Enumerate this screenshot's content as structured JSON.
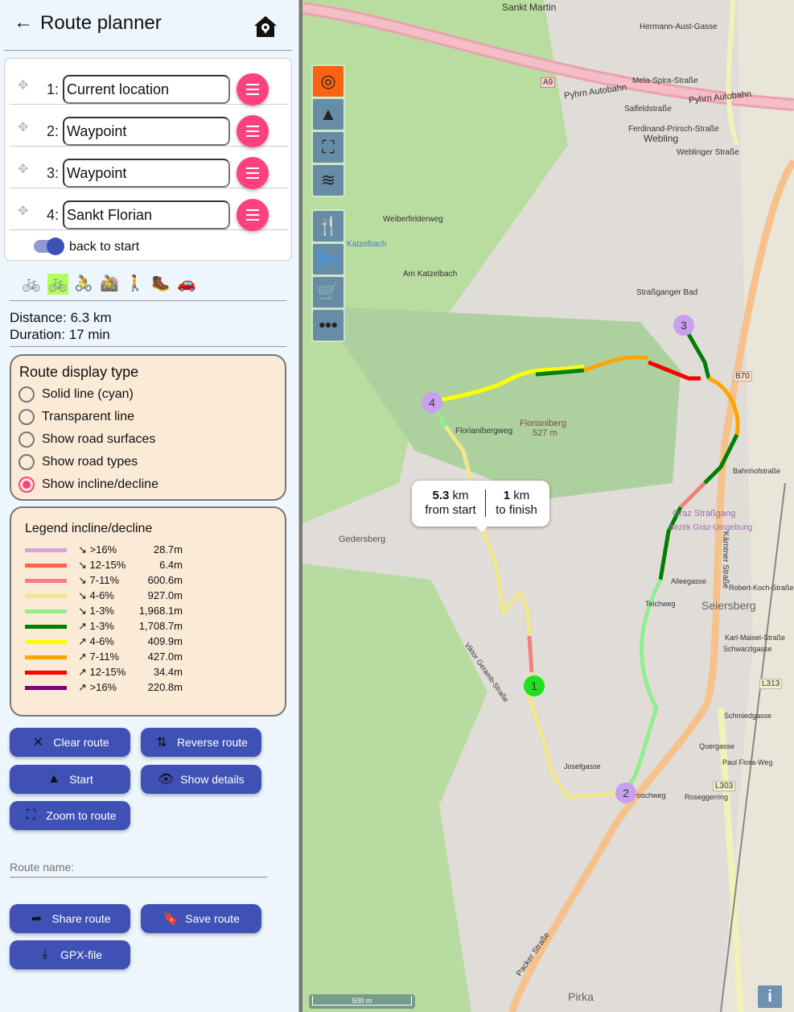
{
  "header": {
    "title": "Route planner",
    "back_icon": "←",
    "home_icon": "home-pin-icon"
  },
  "waypoints": [
    {
      "index": "1:",
      "value": "Current location"
    },
    {
      "index": "2:",
      "value": "Waypoint"
    },
    {
      "index": "3:",
      "value": "Waypoint"
    },
    {
      "index": "4:",
      "value": "Sankt Florian"
    }
  ],
  "back_to_start": {
    "label": "back to start",
    "enabled": true
  },
  "modes": [
    {
      "name": "bike",
      "glyph": "🚲",
      "active": false
    },
    {
      "name": "e-bike",
      "glyph": "🚲",
      "active": true
    },
    {
      "name": "road-bike",
      "glyph": "🚴",
      "active": false
    },
    {
      "name": "mountain-bike",
      "glyph": "🚵",
      "active": false
    },
    {
      "name": "walk",
      "glyph": "🚶",
      "active": false
    },
    {
      "name": "hike",
      "glyph": "🥾",
      "active": false
    },
    {
      "name": "car",
      "glyph": "🚗",
      "active": false
    }
  ],
  "stats": {
    "distance": "Distance: 6.3 km",
    "duration": "Duration: 17 min"
  },
  "display_type": {
    "title": "Route display type",
    "options": [
      {
        "label": "Solid line (cyan)",
        "selected": false
      },
      {
        "label": "Transparent line",
        "selected": false
      },
      {
        "label": "Show road surfaces",
        "selected": false
      },
      {
        "label": "Show road types",
        "selected": false
      },
      {
        "label": "Show incline/decline",
        "selected": true
      }
    ]
  },
  "legend": {
    "title": "Legend incline/decline",
    "items": [
      {
        "label": "↘ >16%",
        "value": "28.7m",
        "color": "#dda0dd"
      },
      {
        "label": "↘ 12-15%",
        "value": "6.4m",
        "color": "#ff6347"
      },
      {
        "label": "↘ 7-11%",
        "value": "600.6m",
        "color": "#f08080"
      },
      {
        "label": "↘ 4-6%",
        "value": "927.0m",
        "color": "#f0e68c"
      },
      {
        "label": "↘ 1-3%",
        "value": "1,968.1m",
        "color": "#90ee90"
      },
      {
        "label": "↗ 1-3%",
        "value": "1,708.7m",
        "color": "#008000"
      },
      {
        "label": "↗ 4-6%",
        "value": "409.9m",
        "color": "#ffff00"
      },
      {
        "label": "↗ 7-11%",
        "value": "427.0m",
        "color": "#ffa500"
      },
      {
        "label": "↗ 12-15%",
        "value": "34.4m",
        "color": "#ff0000"
      },
      {
        "label": "↗ >16%",
        "value": "220.8m",
        "color": "#800080"
      }
    ]
  },
  "buttons": {
    "clear": "Clear route",
    "reverse": "Reverse route",
    "start": "Start",
    "details": "Show details",
    "zoom": "Zoom to route",
    "share": "Share route",
    "save": "Save route",
    "gpx": "GPX-file"
  },
  "route_name": {
    "placeholder": "Route name:",
    "value": ""
  },
  "map": {
    "popup": {
      "from_value": "5.3",
      "from_unit": " km",
      "from_label": "from start",
      "to_value": "1",
      "to_unit": " km",
      "to_label": "to finish"
    },
    "markers": [
      "1",
      "2",
      "3",
      "4"
    ],
    "scale": "500 m",
    "info": "i",
    "labels": [
      "Sankt Martin",
      "Pyhrn Autobahn",
      "Pyhrn Autobahn",
      "A9",
      "Webling",
      "Weblinger Straße",
      "Hermann-Aust-Gasse",
      "Mela-Spira-Straße",
      "Salfeldstraße",
      "Ferdinand-Prirsch-Straße",
      "Weiberfelderweg",
      "Katzelbach",
      "Am Katzelbach",
      "Straßganger Bad",
      "B70",
      "Florianiberg",
      "527 m",
      "Florianibergweg",
      "Gedersberg",
      "Graz Straßgang",
      "Bezirk Graz-Umgebung",
      "Seiersberg",
      "Kärntner Straße",
      "L313",
      "L303",
      "Alleegasse",
      "Teichweg",
      "Schmiedgasse",
      "Quergasse",
      "Josefgasse",
      "Pirka",
      "Packer Straße",
      "Viktor Geramb-Straße",
      "Bahnhofstraße",
      "Robert-Koch-Straße",
      "Karl-Maisel-Straße",
      "Schwarzlgasse",
      "Poschweg",
      "Roseggerring",
      "Paul Flora-Weg"
    ]
  }
}
